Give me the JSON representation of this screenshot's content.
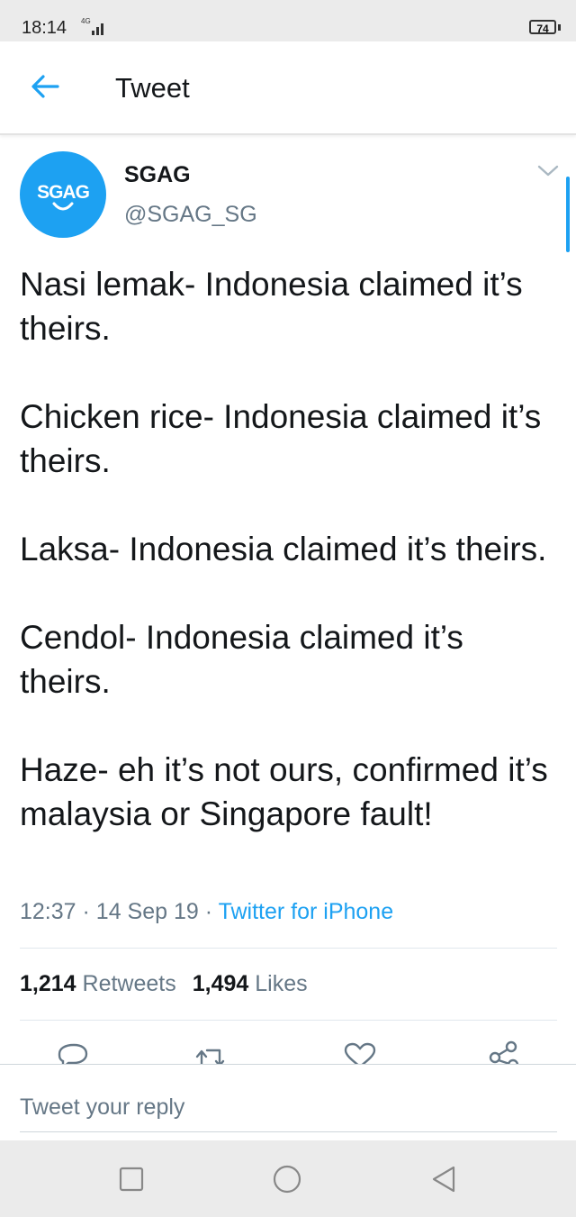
{
  "status_bar": {
    "time": "18:14",
    "network": "4G",
    "battery": "74"
  },
  "header": {
    "title": "Tweet"
  },
  "tweet": {
    "avatar_text": "SGAG",
    "display_name": "SGAG",
    "handle": "@SGAG_SG",
    "text": "Nasi lemak- Indonesia claimed it’s theirs.\n\nChicken rice- Indonesia claimed it’s theirs.\n\nLaksa- Indonesia claimed it’s theirs.\n\nCendol- Indonesia claimed it’s theirs.\n\nHaze- eh it’s not ours, confirmed it’s malaysia or Singapore fault!",
    "time": "12:37",
    "date": "14 Sep 19",
    "separator": "·",
    "source": "Twitter for iPhone"
  },
  "stats": {
    "retweets_count": "1,214",
    "retweets_label": "Retweets",
    "likes_count": "1,494",
    "likes_label": "Likes"
  },
  "reply": {
    "placeholder": "Tweet your reply"
  },
  "colors": {
    "accent": "#1da1f2",
    "secondary_text": "#657786",
    "primary_text": "#14171a"
  },
  "icons": [
    "back-arrow-icon",
    "chevron-down-icon",
    "reply-icon",
    "retweet-icon",
    "like-icon",
    "share-icon",
    "recent-apps-icon",
    "home-icon",
    "back-icon",
    "signal-icon"
  ]
}
